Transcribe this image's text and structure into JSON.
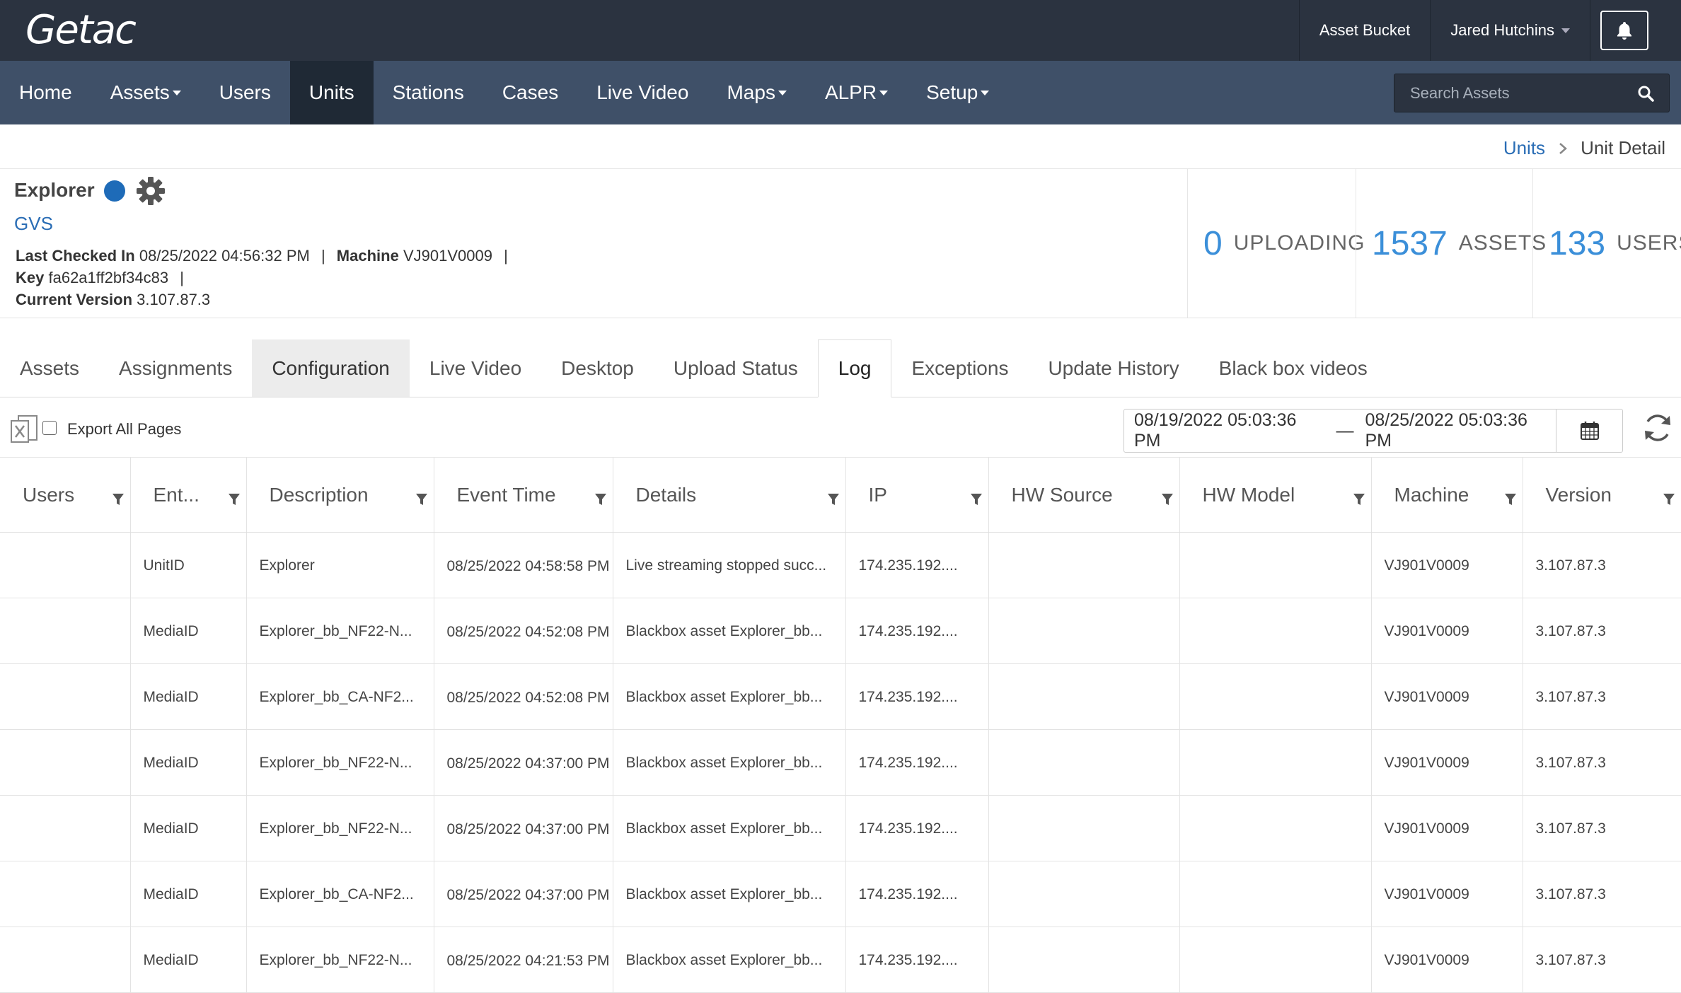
{
  "app": {
    "logo": "Getac"
  },
  "topbar": {
    "asset_bucket": "Asset Bucket",
    "user_name": "Jared Hutchins"
  },
  "nav": {
    "items": [
      {
        "label": "Home",
        "dropdown": false
      },
      {
        "label": "Assets",
        "dropdown": true
      },
      {
        "label": "Users",
        "dropdown": false
      },
      {
        "label": "Units",
        "dropdown": false,
        "active": true
      },
      {
        "label": "Stations",
        "dropdown": false
      },
      {
        "label": "Cases",
        "dropdown": false
      },
      {
        "label": "Live Video",
        "dropdown": false
      },
      {
        "label": "Maps",
        "dropdown": true
      },
      {
        "label": "ALPR",
        "dropdown": true
      },
      {
        "label": "Setup",
        "dropdown": true
      }
    ],
    "search_placeholder": "Search Assets"
  },
  "breadcrumb": {
    "parent": "Units",
    "current": "Unit Detail"
  },
  "unit": {
    "name": "Explorer",
    "group": "GVS",
    "status_color": "#1e6bb8",
    "last_checked_label": "Last Checked In",
    "last_checked_value": "08/25/2022 04:56:32 PM",
    "machine_label": "Machine",
    "machine_value": "VJ901V0009",
    "key_label": "Key",
    "key_value": "fa62a1ff2bf34c83",
    "version_label": "Current Version",
    "version_value": "3.107.87.3"
  },
  "stats": [
    {
      "value": "0",
      "label": "UPLOADING"
    },
    {
      "value": "1537",
      "label": "ASSETS"
    },
    {
      "value": "133",
      "label": "USERS"
    }
  ],
  "tabs": [
    {
      "label": "Assets"
    },
    {
      "label": "Assignments"
    },
    {
      "label": "Configuration",
      "hover": true
    },
    {
      "label": "Live Video"
    },
    {
      "label": "Desktop"
    },
    {
      "label": "Upload Status"
    },
    {
      "label": "Log",
      "active": true
    },
    {
      "label": "Exceptions"
    },
    {
      "label": "Update History"
    },
    {
      "label": "Black box videos"
    }
  ],
  "toolbar": {
    "export_label": "Export All Pages",
    "date_from": "08/19/2022 05:03:36 PM",
    "date_sep": "—",
    "date_to": "08/25/2022 05:03:36 PM"
  },
  "table": {
    "columns": [
      "Users",
      "Ent...",
      "Description",
      "Event Time",
      "Details",
      "IP",
      "HW Source",
      "HW Model",
      "Machine",
      "Version"
    ],
    "rows": [
      [
        "",
        "UnitID",
        "Explorer",
        "08/25/2022 04:58:58 PM",
        "Live streaming stopped succ...",
        "174.235.192....",
        "",
        "",
        "VJ901V0009",
        "3.107.87.3"
      ],
      [
        "",
        "MediaID",
        "Explorer_bb_NF22-N...",
        "08/25/2022 04:52:08 PM",
        "Blackbox asset Explorer_bb...",
        "174.235.192....",
        "",
        "",
        "VJ901V0009",
        "3.107.87.3"
      ],
      [
        "",
        "MediaID",
        "Explorer_bb_CA-NF2...",
        "08/25/2022 04:52:08 PM",
        "Blackbox asset Explorer_bb...",
        "174.235.192....",
        "",
        "",
        "VJ901V0009",
        "3.107.87.3"
      ],
      [
        "",
        "MediaID",
        "Explorer_bb_NF22-N...",
        "08/25/2022 04:37:00 PM",
        "Blackbox asset Explorer_bb...",
        "174.235.192....",
        "",
        "",
        "VJ901V0009",
        "3.107.87.3"
      ],
      [
        "",
        "MediaID",
        "Explorer_bb_NF22-N...",
        "08/25/2022 04:37:00 PM",
        "Blackbox asset Explorer_bb...",
        "174.235.192....",
        "",
        "",
        "VJ901V0009",
        "3.107.87.3"
      ],
      [
        "",
        "MediaID",
        "Explorer_bb_CA-NF2...",
        "08/25/2022 04:37:00 PM",
        "Blackbox asset Explorer_bb...",
        "174.235.192....",
        "",
        "",
        "VJ901V0009",
        "3.107.87.3"
      ],
      [
        "",
        "MediaID",
        "Explorer_bb_NF22-N...",
        "08/25/2022 04:21:53 PM",
        "Blackbox asset Explorer_bb...",
        "174.235.192....",
        "",
        "",
        "VJ901V0009",
        "3.107.87.3"
      ]
    ]
  }
}
